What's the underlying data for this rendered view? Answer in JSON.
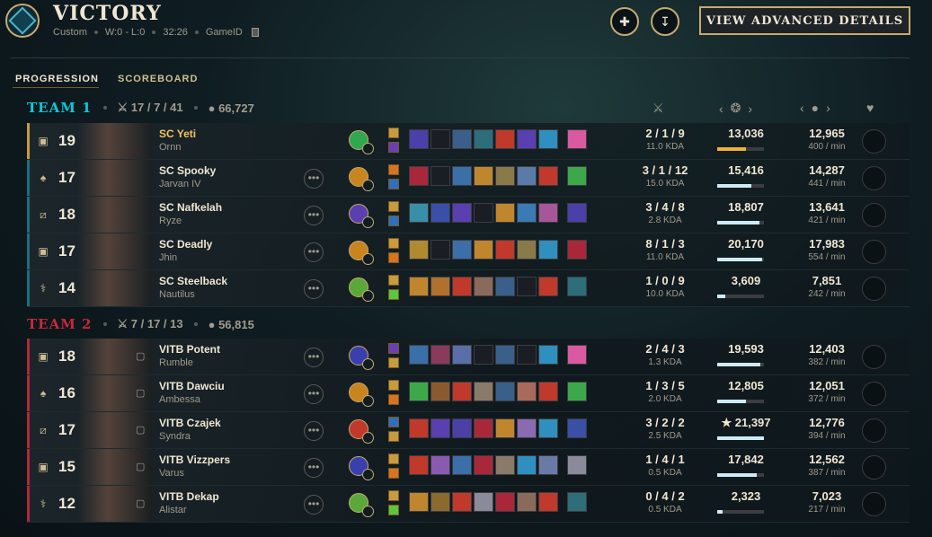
{
  "header": {
    "title": "VICTORY",
    "mode": "Custom",
    "record": "W:0 - L:0",
    "duration": "32:26",
    "game_id_label": "GameID",
    "advanced_label": "VIEW ADVANCED DETAILS"
  },
  "tabs": [
    "PROGRESSION",
    "SCOREBOARD"
  ],
  "teams": [
    {
      "name": "TEAM 1",
      "color": "#0ac8d9",
      "kda": "17 / 7 / 41",
      "gold": "66,727",
      "players": [
        {
          "role": "top-icon",
          "level": "19",
          "name": "SC Yeti",
          "champion": "Ornn",
          "kda": "2 / 1 / 9",
          "kda_ratio": "11.0 KDA",
          "damage": "13,036",
          "damage_fraction": 0.62,
          "gold": "12,965",
          "gpm": "400 / min",
          "self": true,
          "rune_color": "#2fa84f",
          "spells": [
            "#c89b3c",
            "#6a3fb5"
          ],
          "items": [
            "#4b3fa8",
            "#1a1e24",
            "#3a5f8a",
            "#2e6d7a",
            "#c0392b",
            "#5a3fb0",
            "#2f8fbf"
          ],
          "trinket": "#d95aa0"
        },
        {
          "role": "jungle-icon",
          "level": "17",
          "name": "SC Spooky",
          "champion": "Jarvan IV",
          "kda": "3 / 1 / 12",
          "kda_ratio": "15.0 KDA",
          "damage": "15,416",
          "damage_fraction": 0.74,
          "gold": "14,287",
          "gpm": "441 / min",
          "self": false,
          "rune_color": "#c8841e",
          "spells": [
            "#d9731e",
            "#2f6fbf"
          ],
          "items": [
            "#a8283a",
            "#1a1e24",
            "#3a6fa8",
            "#c0862e",
            "#8a7a4a",
            "#5a7aa8",
            "#c0392b"
          ],
          "trinket": "#3ca84a"
        },
        {
          "role": "mid-icon",
          "level": "18",
          "name": "SC Nafkelah",
          "champion": "Ryze",
          "kda": "3 / 4 / 8",
          "kda_ratio": "2.8 KDA",
          "damage": "18,807",
          "damage_fraction": 0.9,
          "gold": "13,641",
          "gpm": "421 / min",
          "self": false,
          "rune_color": "#5a3fb0",
          "spells": [
            "#c89b3c",
            "#2f6fbf"
          ],
          "items": [
            "#3a8fa8",
            "#3a4fa8",
            "#5a3fb0",
            "#1a1e24",
            "#c0862e",
            "#3a7ab5",
            "#a8569a"
          ],
          "trinket": "#4b3fa8"
        },
        {
          "role": "bottom-icon",
          "level": "17",
          "name": "SC Deadly",
          "champion": "Jhin",
          "kda": "8 / 1 / 3",
          "kda_ratio": "11.0 KDA",
          "damage": "20,170",
          "damage_fraction": 0.97,
          "gold": "17,983",
          "gpm": "554 / min",
          "self": false,
          "rune_color": "#c8841e",
          "spells": [
            "#c89b3c",
            "#d9731e"
          ],
          "items": [
            "#b08a2e",
            "#1a1e24",
            "#3a6fa8",
            "#c0862e",
            "#c0392b",
            "#8a7a4a",
            "#2f8fbf"
          ],
          "trinket": "#a8283a"
        },
        {
          "role": "support-icon",
          "level": "14",
          "name": "SC Steelback",
          "champion": "Nautilus",
          "kda": "1 / 0 / 9",
          "kda_ratio": "10.0 KDA",
          "damage": "3,609",
          "damage_fraction": 0.17,
          "gold": "7,851",
          "gpm": "242 / min",
          "self": false,
          "rune_color": "#5aa83a",
          "spells": [
            "#c89b3c",
            "#5ac83a"
          ],
          "items": [
            "#c0862e",
            "#b0702e",
            "#c0392b",
            "#8a6a5a",
            "#3a5f8a",
            "#1a1e24",
            "#c0392b"
          ],
          "trinket": "#2e6d7a"
        }
      ]
    },
    {
      "name": "TEAM 2",
      "color": "#c8283a",
      "kda": "7 / 17 / 13",
      "gold": "56,815",
      "players": [
        {
          "role": "top-icon",
          "level": "18",
          "name": "VITB Potent",
          "champion": "Rumble",
          "kda": "2 / 4 / 3",
          "kda_ratio": "1.3 KDA",
          "damage": "19,593",
          "damage_fraction": 0.93,
          "gold": "12,403",
          "gpm": "382 / min",
          "self": false,
          "rune_color": "#3a3fb0",
          "spells": [
            "#6a3fb5",
            "#c89b3c"
          ],
          "items": [
            "#3a6fa8",
            "#8a3a5a",
            "#5a6fa8",
            "#1a1e24",
            "#3a5f8a",
            "#1a1e24",
            "#2f8fbf"
          ],
          "trinket": "#d95aa0"
        },
        {
          "role": "jungle-icon",
          "level": "16",
          "name": "VITB Dawciu",
          "champion": "Ambessa",
          "kda": "1 / 3 / 5",
          "kda_ratio": "2.0 KDA",
          "damage": "12,805",
          "damage_fraction": 0.62,
          "gold": "12,051",
          "gpm": "372 / min",
          "self": false,
          "rune_color": "#c8841e",
          "spells": [
            "#c89b3c",
            "#d9731e"
          ],
          "items": [
            "#3ca84a",
            "#8a5a2e",
            "#c0392b",
            "#8a7a6a",
            "#3a5f8a",
            "#a86a5a",
            "#c0392b"
          ],
          "trinket": "#3ca84a"
        },
        {
          "role": "mid-icon",
          "level": "17",
          "name": "VITB Czajek",
          "champion": "Syndra",
          "kda": "3 / 2 / 2",
          "kda_ratio": "2.5 KDA",
          "damage": "★ 21,397",
          "damage_fraction": 1.0,
          "gold": "12,776",
          "gpm": "394 / min",
          "self": false,
          "rune_color": "#c0392b",
          "spells": [
            "#2f6fbf",
            "#c89b3c"
          ],
          "items": [
            "#c0392b",
            "#5a3fb0",
            "#4b3fa8",
            "#a8283a",
            "#c0862e",
            "#8a6ab0",
            "#2f8fbf"
          ],
          "trinket": "#3a4fa8"
        },
        {
          "role": "bottom-icon",
          "level": "15",
          "name": "VITB Vizzpers",
          "champion": "Varus",
          "kda": "1 / 4 / 1",
          "kda_ratio": "0.5 KDA",
          "damage": "17,842",
          "damage_fraction": 0.85,
          "gold": "12,562",
          "gpm": "387 / min",
          "self": false,
          "rune_color": "#3a3fb0",
          "spells": [
            "#c89b3c",
            "#d9731e"
          ],
          "items": [
            "#c0392b",
            "#8a5ab0",
            "#3a6fa8",
            "#a8283a",
            "#8a7a6a",
            "#2f8fbf",
            "#6a7aa8"
          ],
          "trinket": "#8a8a9a"
        },
        {
          "role": "support-icon",
          "level": "12",
          "name": "VITB Dekap",
          "champion": "Alistar",
          "kda": "0 / 4 / 2",
          "kda_ratio": "0.5 KDA",
          "damage": "2,323",
          "damage_fraction": 0.11,
          "gold": "7,023",
          "gpm": "217 / min",
          "self": false,
          "rune_color": "#5aa83a",
          "spells": [
            "#c89b3c",
            "#5ac83a"
          ],
          "items": [
            "#c0862e",
            "#8a6a2e",
            "#c0392b",
            "#8a8a9a",
            "#a8283a",
            "#8a6a5a",
            "#c0392b"
          ],
          "trinket": "#2e6d7a"
        }
      ]
    }
  ]
}
